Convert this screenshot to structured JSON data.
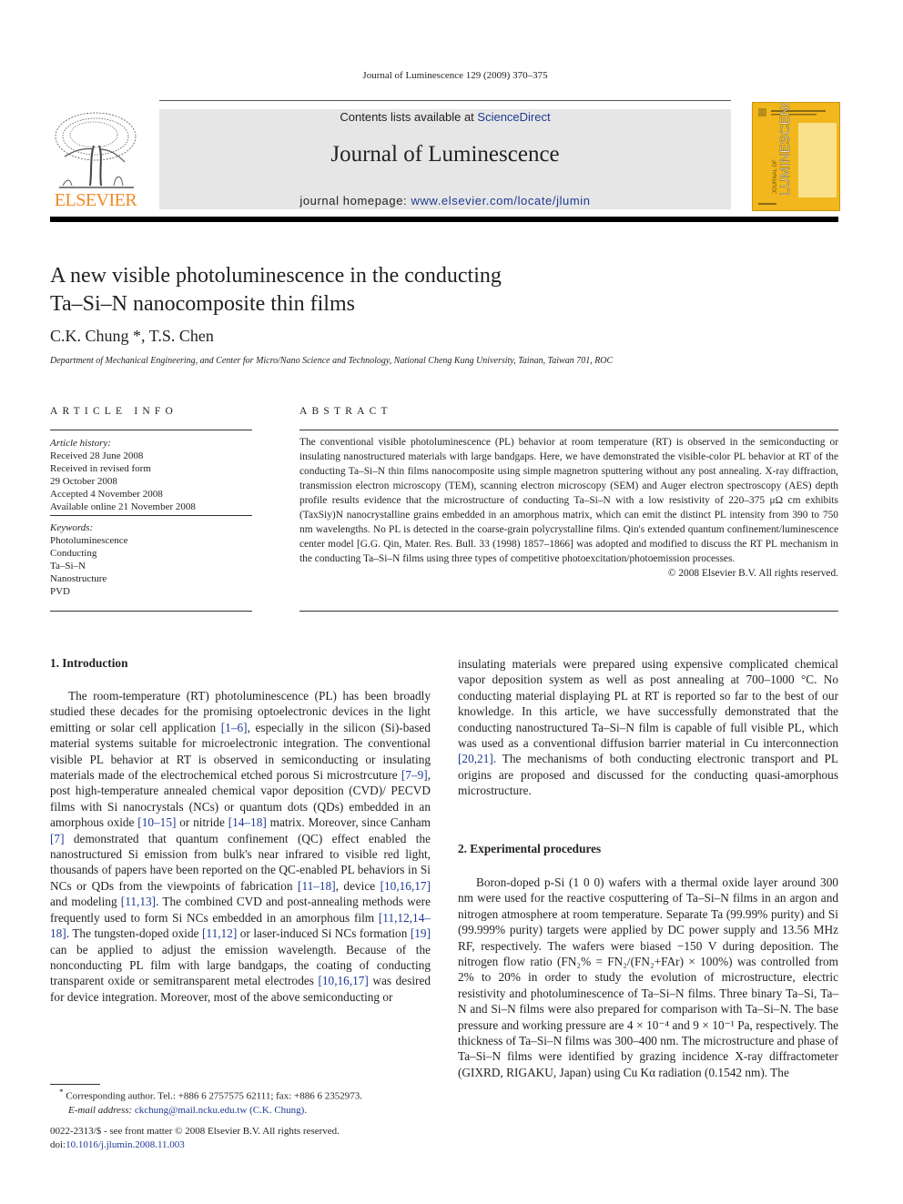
{
  "header": {
    "journal_ref": "Journal of Luminescence 129 (2009) 370–375",
    "contents_prefix": "Contents lists available at ",
    "contents_link": "ScienceDirect",
    "journal_title": "Journal of Luminescence",
    "homepage_prefix": "journal homepage: ",
    "homepage_link": "www.elsevier.com/locate/jlumin",
    "publisher_logo_text": "ELSEVIER",
    "cover_text": "LUMINESCENCE",
    "cover_subtext": "JOURNAL OF"
  },
  "article": {
    "title_line1": "A new visible photoluminescence in the conducting",
    "title_line2": "Ta–Si–N nanocomposite thin films",
    "author1": "C.K. Chung",
    "author1_mark": "*",
    "author_sep": ", ",
    "author2": "T.S. Chen",
    "affiliation": "Department of Mechanical Engineering, and Center for Micro/Nano Science and Technology, National Cheng Kung University, Tainan, Taiwan 701, ROC"
  },
  "article_info": {
    "heading": "ARTICLE INFO",
    "history_label": "Article history:",
    "history": [
      "Received 28 June 2008",
      "Received in revised form",
      "29 October 2008",
      "Accepted 4 November 2008",
      "Available online 21 November 2008"
    ],
    "keywords_label": "Keywords:",
    "keywords": [
      "Photoluminescence",
      "Conducting",
      "Ta–Si–N",
      "Nanostructure",
      "PVD"
    ]
  },
  "abstract": {
    "heading": "ABSTRACT",
    "text": "The conventional visible photoluminescence (PL) behavior at room temperature (RT) is observed in the semiconducting or insulating nanostructured materials with large bandgaps. Here, we have demonstrated the visible-color PL behavior at RT of the conducting Ta–Si–N thin films nanocomposite using simple magnetron sputtering without any post annealing. X-ray diffraction, transmission electron microscopy (TEM), scanning electron microscopy (SEM) and Auger electron spectroscopy (AES) depth profile results evidence that the microstructure of conducting Ta–Si–N with a low resistivity of 220–375 μΩ cm exhibits (TaxSiy)N nanocrystalline grains embedded in an amorphous matrix, which can emit the distinct PL intensity from 390 to 750 nm wavelengths. No PL is detected in the coarse-grain polycrystalline films. Qin's extended quantum confinement/luminescence center model [G.G. Qin, Mater. Res. Bull. 33 (1998) 1857–1866] was adopted and modified to discuss the RT PL mechanism in the conducting Ta–Si–N films using three types of competitive photoexcitation/photoemission processes.",
    "copyright": "© 2008 Elsevier B.V. All rights reserved."
  },
  "sections": {
    "intro_heading": "1.  Introduction",
    "intro_parts": [
      "The room-temperature (RT) photoluminescence (PL) has been broadly studied these decades for the promising optoelectronic devices in the light emitting or solar cell application ",
      "[1–6]",
      ", especially in the silicon (Si)-based material systems suitable for microelectronic integration. The conventional visible PL behavior at RT is observed in semiconducting or insulating materials made of the electrochemical etched porous Si microstrcuture ",
      "[7–9]",
      ", post high-temperature annealed chemical vapor deposition (CVD)/ PECVD films with Si nanocrystals (NCs) or quantum dots (QDs) embedded in an amorphous oxide ",
      "[10–15]",
      " or nitride ",
      "[14–18]",
      " matrix. Moreover, since Canham ",
      "[7]",
      " demonstrated that quantum confinement (QC) effect enabled the nanostructured Si emission from bulk's near infrared to visible red light, thousands of papers have been reported on the QC-enabled PL behaviors in Si NCs or QDs from the viewpoints of fabrication ",
      "[11–18]",
      ", device ",
      "[10,16,17]",
      " and modeling ",
      "[11,13]",
      ". The combined CVD and post-annealing methods were frequently used to form Si NCs embedded in an amorphous film ",
      "[11,12,14–18]",
      ". The tungsten-doped oxide ",
      "[11,12]",
      " or laser-induced Si NCs formation ",
      "[19]",
      " can be applied to adjust the emission wavelength. Because of the nonconducting PL film with large bandgaps, the coating of conducting transparent oxide or semitransparent metal electrodes ",
      "[10,16,17]",
      " was desired for device integration. Moreover, most of the above semiconducting or"
    ],
    "intro_continued_parts": [
      "insulating materials were prepared using expensive complicated chemical vapor deposition system as well as post annealing at 700–1000 °C. No conducting material displaying PL at RT is reported so far to the best of our knowledge. In this article, we have successfully demonstrated that the conducting nanostructured Ta–Si–N film is capable of full visible PL, which was used as a conventional diffusion barrier material in Cu interconnection ",
      "[20,21]",
      ". The mechanisms of both conducting electronic transport and PL origins are proposed and discussed for the conducting quasi-amorphous microstructure."
    ],
    "exp_heading": "2.  Experimental procedures",
    "exp_text_a": "Boron-doped p-Si (1 0 0) wafers with a thermal oxide layer around 300 nm were used for the reactive cosputtering of Ta–Si–N films in an argon and nitrogen atmosphere at room temperature. Separate Ta (99.99% purity) and Si (99.999% purity) targets were applied by DC power supply and 13.56 MHz RF, respectively. The wafers were biased −150 V during deposition. The nitrogen flow ratio (FN₂% = FN₂/(FN₂+FAr) × 100%) was controlled from 2% to 20% in order to study the evolution of microstructure, electric resistivity and photoluminescence of Ta–Si–N films. Three binary Ta–Si, Ta–N and Si–N films were also prepared for comparison with Ta–Si–N. The base pressure and working pressure are 4 × 10⁻⁴ and 9 × 10⁻¹ Pa, respectively. The thickness of Ta–Si–N films was 300–400 nm. The microstructure and phase of Ta–Si–N films were identified by grazing incidence X-ray diffractometer (GIXRD, RIGAKU, Japan) using Cu Kα radiation (0.1542 nm). The"
  },
  "footer": {
    "corresponding_mark": "*",
    "corresponding": " Corresponding author. Tel.: +886 6 2757575 62111; fax: +886 6 2352973.",
    "email_label": "E-mail address: ",
    "email_link": "ckchung@mail.ncku.edu.tw (C.K. Chung).",
    "front_matter": "0022-2313/$ - see front matter © 2008 Elsevier B.V. All rights reserved.",
    "doi_label": "doi:",
    "doi_link": "10.1016/j.jlumin.2008.11.003"
  },
  "colors": {
    "link": "#1f3a93",
    "elsevier_orange": "#f08a24",
    "cover_yellow": "#f2b71c",
    "masthead_gray": "#e6e6e6"
  }
}
